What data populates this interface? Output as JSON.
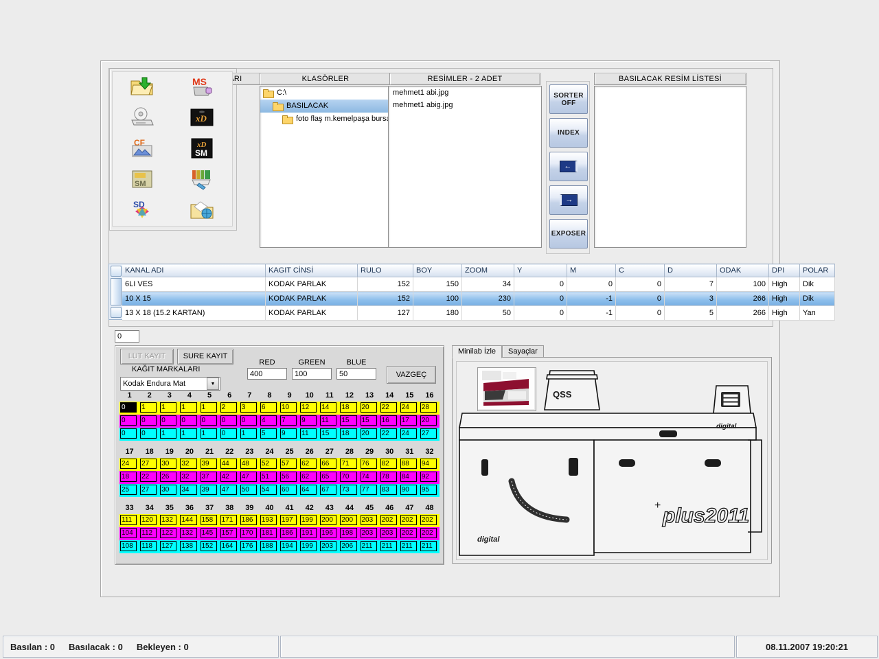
{
  "panels": {
    "sources_title": "RESİM KAYNAKLARI",
    "folders_title": "KLASÖRLER",
    "pictures_title": "RESİMLER - 2 ADET",
    "printlist_title": "BASILACAK RESİM LİSTESİ"
  },
  "sources": [
    {
      "name": "folder-open-download-icon"
    },
    {
      "name": "memory-stick-ms-icon"
    },
    {
      "name": "cd-drive-icon"
    },
    {
      "name": "xd-card-icon"
    },
    {
      "name": "compactflash-cf-icon"
    },
    {
      "name": "xd-sm-card-icon"
    },
    {
      "name": "smartmedia-sm-icon"
    },
    {
      "name": "usb-flash-drive-icon"
    },
    {
      "name": "sd-card-icon"
    },
    {
      "name": "network-photo-folder-icon"
    }
  ],
  "folders": [
    {
      "label": "C:\\",
      "indent": 0,
      "selected": false
    },
    {
      "label": "BASILACAK",
      "indent": 1,
      "selected": true
    },
    {
      "label": "foto flaş m.kemelpaşa bursa",
      "indent": 2,
      "selected": false
    }
  ],
  "pictures": [
    "mehmet1 abi.jpg",
    "mehmet1 abig.jpg"
  ],
  "printlist": [],
  "mid_buttons": [
    {
      "label_1": "SORTER",
      "label_2": "OFF",
      "kind": "text"
    },
    {
      "label_1": "INDEX",
      "label_2": "",
      "kind": "text"
    },
    {
      "label_1": "",
      "label_2": "",
      "kind": "arrow-left"
    },
    {
      "label_1": "",
      "label_2": "",
      "kind": "arrow-right"
    },
    {
      "label_1": "EXPOSER",
      "label_2": "",
      "kind": "text"
    }
  ],
  "table": {
    "columns": [
      "KANAL ADI",
      "KAGIT CİNSİ",
      "RULO",
      "BOY",
      "ZOOM",
      "Y",
      "M",
      "C",
      "D",
      "ODAK",
      "DPI",
      "POLAR"
    ],
    "rows": [
      {
        "selected": false,
        "cells": [
          "6LI VES",
          "KODAK PARLAK",
          "152",
          "150",
          "34",
          "0",
          "0",
          "0",
          "7",
          "100",
          "High",
          "Dik"
        ]
      },
      {
        "selected": true,
        "cells": [
          "10 X 15",
          "KODAK PARLAK",
          "152",
          "100",
          "230",
          "0",
          "-1",
          "0",
          "3",
          "266",
          "High",
          "Dik"
        ]
      },
      {
        "selected": false,
        "cells": [
          "13 X 18 (15.2 KARTAN)",
          "KODAK PARLAK",
          "127",
          "180",
          "50",
          "0",
          "-1",
          "0",
          "5",
          "266",
          "High",
          "Yan"
        ]
      }
    ]
  },
  "bottom": {
    "counter_field": "0",
    "lut_kayit_label": "LUT KAYIT",
    "sure_kayit_label": "SURE KAYIT",
    "paper_brands_label": "KAĞIT MARKALARI",
    "paper_brand_value": "Kodak Endura Mat",
    "cancel_label": "VAZGEÇ",
    "rgb": [
      {
        "label": "RED",
        "value": "400"
      },
      {
        "label": "GREEN",
        "value": "100"
      },
      {
        "label": "BLUE",
        "value": "50"
      }
    ]
  },
  "color_grid": {
    "blocks": [
      {
        "headers": [
          "1",
          "2",
          "3",
          "4",
          "5",
          "6",
          "7",
          "8",
          "9",
          "10",
          "11",
          "12",
          "13",
          "14",
          "15",
          "16"
        ],
        "yellow": [
          "0",
          "1",
          "1",
          "1",
          "1",
          "2",
          "3",
          "6",
          "10",
          "12",
          "14",
          "18",
          "20",
          "22",
          "24",
          "28"
        ],
        "magenta": [
          "0",
          "0",
          "0",
          "0",
          "0",
          "0",
          "0",
          "4",
          "7",
          "9",
          "11",
          "15",
          "15",
          "16",
          "17",
          "20"
        ],
        "cyan": [
          "0",
          "0",
          "1",
          "1",
          "1",
          "0",
          "1",
          "5",
          "9",
          "11",
          "15",
          "18",
          "20",
          "22",
          "24",
          "27"
        ],
        "focus_cell": 0
      },
      {
        "headers": [
          "17",
          "18",
          "19",
          "20",
          "21",
          "22",
          "23",
          "24",
          "25",
          "26",
          "27",
          "28",
          "29",
          "30",
          "31",
          "32"
        ],
        "yellow": [
          "24",
          "27",
          "30",
          "32",
          "39",
          "44",
          "48",
          "52",
          "57",
          "62",
          "66",
          "71",
          "76",
          "82",
          "88",
          "94"
        ],
        "magenta": [
          "18",
          "22",
          "26",
          "32",
          "37",
          "42",
          "47",
          "51",
          "56",
          "62",
          "65",
          "70",
          "74",
          "78",
          "84",
          "92"
        ],
        "cyan": [
          "25",
          "27",
          "30",
          "34",
          "39",
          "47",
          "50",
          "54",
          "60",
          "64",
          "67",
          "73",
          "77",
          "83",
          "90",
          "95"
        ],
        "focus_cell": -1
      },
      {
        "headers": [
          "33",
          "34",
          "35",
          "36",
          "37",
          "38",
          "39",
          "40",
          "41",
          "42",
          "43",
          "44",
          "45",
          "46",
          "47",
          "48"
        ],
        "yellow": [
          "111",
          "120",
          "132",
          "144",
          "158",
          "171",
          "186",
          "193",
          "197",
          "199",
          "200",
          "200",
          "203",
          "202",
          "202",
          "202"
        ],
        "magenta": [
          "104",
          "112",
          "122",
          "132",
          "145",
          "157",
          "170",
          "181",
          "186",
          "191",
          "196",
          "198",
          "203",
          "203",
          "202",
          "202"
        ],
        "cyan": [
          "108",
          "118",
          "127",
          "138",
          "152",
          "164",
          "176",
          "188",
          "194",
          "199",
          "203",
          "206",
          "211",
          "211",
          "211",
          "211"
        ],
        "focus_cell": -1
      }
    ]
  },
  "tabs": [
    {
      "label": "Minilab İzle",
      "active": true
    },
    {
      "label": "Sayaçlar",
      "active": false
    }
  ],
  "minilab": {
    "brand_top": "QSS",
    "brand_digital_top": "digital",
    "brand_digital_bottom": "digital",
    "brand_model": "plus2011"
  },
  "statusbar": {
    "printed_label": "Basılan : 0",
    "to_print_label": "Basılacak : 0",
    "waiting_label": "Bekleyen : 0",
    "datetime": "08.11.2007 19:20:21"
  },
  "colors": {
    "yellow": "#ffff00",
    "magenta": "#ff00ff",
    "cyan": "#00ffff",
    "selection": "#8fc0ec",
    "window": "#ececec"
  }
}
